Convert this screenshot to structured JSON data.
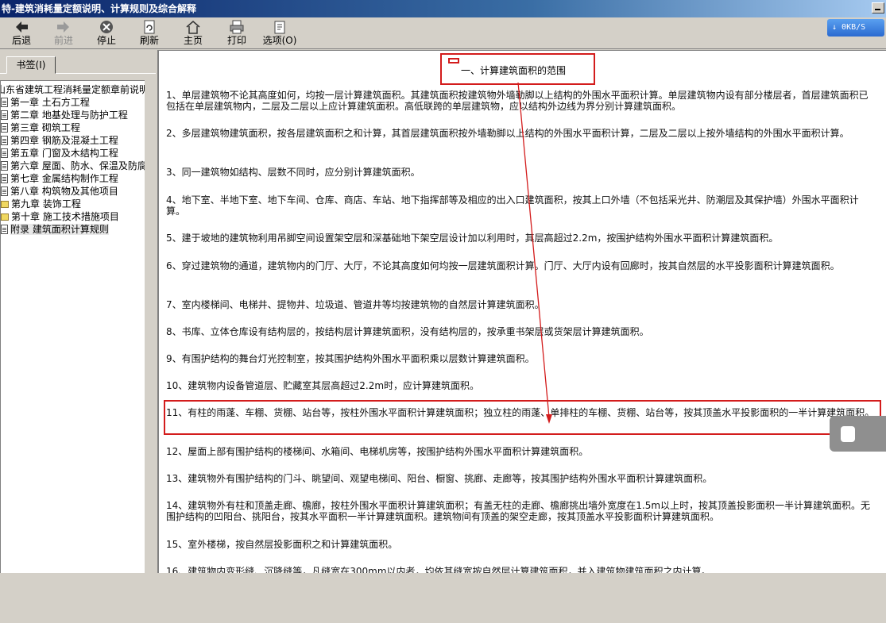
{
  "window": {
    "title": "特-建筑消耗量定额说明、计算规则及综合解释"
  },
  "toolbar": {
    "buttons": [
      {
        "id": "back",
        "label": "后退",
        "icon": "back-arrow-icon",
        "enabled": true
      },
      {
        "id": "forward",
        "label": "前进",
        "icon": "forward-arrow-icon",
        "enabled": false
      },
      {
        "id": "stop",
        "label": "停止",
        "icon": "stop-icon",
        "enabled": true
      },
      {
        "id": "refresh",
        "label": "刷新",
        "icon": "refresh-icon",
        "enabled": true
      },
      {
        "id": "home",
        "label": "主页",
        "icon": "home-icon",
        "enabled": true
      },
      {
        "id": "print",
        "label": "打印",
        "icon": "print-icon",
        "enabled": true
      },
      {
        "id": "options",
        "label": "选项(O)",
        "icon": "options-icon",
        "enabled": true
      }
    ],
    "speed": "0KB/S"
  },
  "sidebar": {
    "tab_label": "书签(I)",
    "root_label": "山东省建筑工程消耗量定额章前说明",
    "items": [
      {
        "label": "第一章 土石方工程",
        "icon": "document-icon"
      },
      {
        "label": "第二章 地基处理与防护工程",
        "icon": "document-icon"
      },
      {
        "label": "第三章 砌筑工程",
        "icon": "document-icon"
      },
      {
        "label": "第四章 钢筋及混凝土工程",
        "icon": "document-icon"
      },
      {
        "label": "第五章 门窗及木结构工程",
        "icon": "document-icon"
      },
      {
        "label": "第六章 屋面、防水、保温及防腐",
        "icon": "document-icon"
      },
      {
        "label": "第七章 金属结构制作工程",
        "icon": "document-icon"
      },
      {
        "label": "第八章 构筑物及其他项目",
        "icon": "document-icon"
      },
      {
        "label": "第九章 装饰工程",
        "icon": "folder-icon"
      },
      {
        "label": "第十章 施工技术措施项目",
        "icon": "folder-icon"
      },
      {
        "label": "附录 建筑面积计算规则",
        "icon": "document-icon",
        "selected": true
      }
    ]
  },
  "content": {
    "heading": "一、计算建筑面积的范围",
    "paragraphs": [
      "1、单层建筑物不论其高度如何，均按一层计算建筑面积。其建筑面积按建筑物外墙勒脚以上结构的外围水平面积计算。单层建筑物内设有部分楼层者，首层建筑面积已包括在单层建筑物内，二层及二层以上应计算建筑面积。高低联跨的单层建筑物，应以结构外边线为界分别计算建筑面积。",
      "2、多层建筑物建筑面积，按各层建筑面积之和计算，其首层建筑面积按外墙勒脚以上结构的外围水平面积计算，二层及二层以上按外墙结构的外围水平面积计算。",
      "3、同一建筑物如结构、层数不同时，应分别计算建筑面积。",
      "4、地下室、半地下室、地下车间、仓库、商店、车站、地下指挥部等及相应的出入口建筑面积，按其上口外墙（不包括采光井、防潮层及其保护墙）外围水平面积计算。",
      "5、建于坡地的建筑物利用吊脚空间设置架空层和深基础地下架空层设计加以利用时，其层高超过2.2m，按围护结构外围水平面积计算建筑面积。",
      "6、穿过建筑物的通道，建筑物内的门厅、大厅，不论其高度如何均按一层建筑面积计算。门厅、大厅内设有回廊时，按其自然层的水平投影面积计算建筑面积。",
      "7、室内楼梯间、电梯井、提物井、垃圾道、管道井等均按建筑物的自然层计算建筑面积。",
      "8、书库、立体仓库设有结构层的，按结构层计算建筑面积，没有结构层的，按承重书架层或货架层计算建筑面积。",
      "9、有围护结构的舞台灯光控制室，按其围护结构外围水平面积乘以层数计算建筑面积。",
      "10、建筑物内设备管道层、贮藏室其层高超过2.2m时，应计算建筑面积。",
      "11、有柱的雨蓬、车棚、货棚、站台等，按柱外围水平面积计算建筑面积；独立柱的雨蓬、单排柱的车棚、货棚、站台等，按其顶盖水平投影面积的一半计算建筑面积。",
      "12、屋面上部有围护结构的楼梯间、水箱间、电梯机房等，按围护结构外围水平面积计算建筑面积。",
      "13、建筑物外有围护结构的门斗、眺望间、观望电梯间、阳台、橱窗、挑廊、走廊等，按其围护结构外围水平面积计算建筑面积。",
      "14、建筑物外有柱和顶盖走廊、檐廊，按柱外围水平面积计算建筑面积；有盖无柱的走廊、檐廊挑出墙外宽度在1.5m以上时，按其顶盖投影面积一半计算建筑面积。无围护结构的凹阳台、挑阳台，按其水平面积一半计算建筑面积。建筑物间有顶盖的架空走廊，按其顶盖水平投影面积计算建筑面积。",
      "15、室外楼梯，按自然层投影面积之和计算建筑面积。",
      "16、建筑物内变形缝、沉降缝等，凡缝宽在300mm以内者，均依其缝宽按自然层计算建筑面积，并入建筑物建筑面积之内计算。"
    ]
  },
  "annotation_color": "#d31c1c"
}
